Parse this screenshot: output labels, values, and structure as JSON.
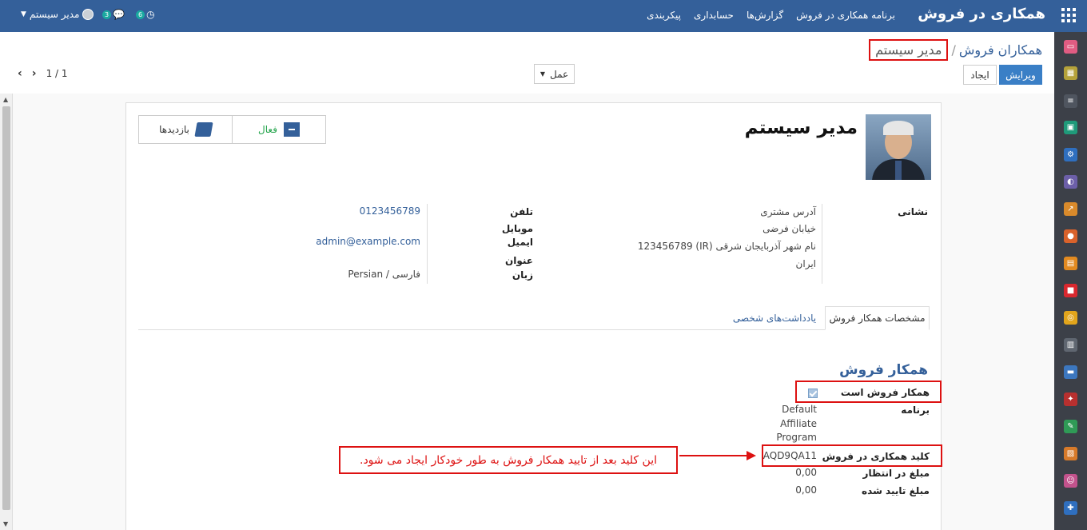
{
  "navbar": {
    "brand": "همکاری در فروش",
    "menu": [
      "برنامه همکاری در فروش",
      "گزارش‌ها",
      "حسابداری",
      "پیکربندی"
    ],
    "user_name": "مدیر سیستم",
    "messages_count": "3",
    "activities_count": "6"
  },
  "breadcrumb": {
    "parent": "همکاران فروش",
    "separator": "/",
    "current": "مدیر سیستم"
  },
  "toolbar": {
    "edit_label": "ویرایش",
    "create_label": "ایجاد",
    "action_label": "عمل",
    "pager": "1 / 1"
  },
  "record": {
    "name": "مدیر سیستم",
    "smart_buttons": {
      "active_label": "فعال",
      "visits_label": "بازدیدها"
    },
    "address_label": "نشانی",
    "address_lines": [
      "آدرس مشتری",
      "خیابان فرضی",
      "نام شهر  آذربایجان شرقی (IR)  123456789",
      "ایران"
    ],
    "phone_label": "تلفن",
    "phone": "0123456789",
    "mobile_label": "موبایل",
    "email_label": "ایمیل",
    "email": "admin@example.com",
    "title_label": "عنوان",
    "language_label": "زبان",
    "language": "Persian / فارسی"
  },
  "tabs": [
    "مشخصات همکار فروش",
    "یادداشت‌های شخصی"
  ],
  "affiliate": {
    "section_title": "همکار فروش",
    "is_affiliate_label": "همکار فروش است",
    "is_affiliate": true,
    "program_label": "برنامه",
    "program_lines": [
      "Default",
      "Affiliate",
      "Program"
    ],
    "key_label": "کلید همکاری در فروش",
    "key": "AQD9QA11",
    "pending_label": "مبلغ در انتظار",
    "pending": "0,00",
    "approved_label": "مبلغ تایید شده",
    "approved": "0,00"
  },
  "annotation": {
    "note": "این کلید بعد از تایید همکار فروش به طور خودکار ایجاد می شود."
  },
  "colors": {
    "navbar": "#34609a",
    "accent": "#3a7fc6",
    "highlight": "#dd1111",
    "active_green": "#21a34a"
  }
}
